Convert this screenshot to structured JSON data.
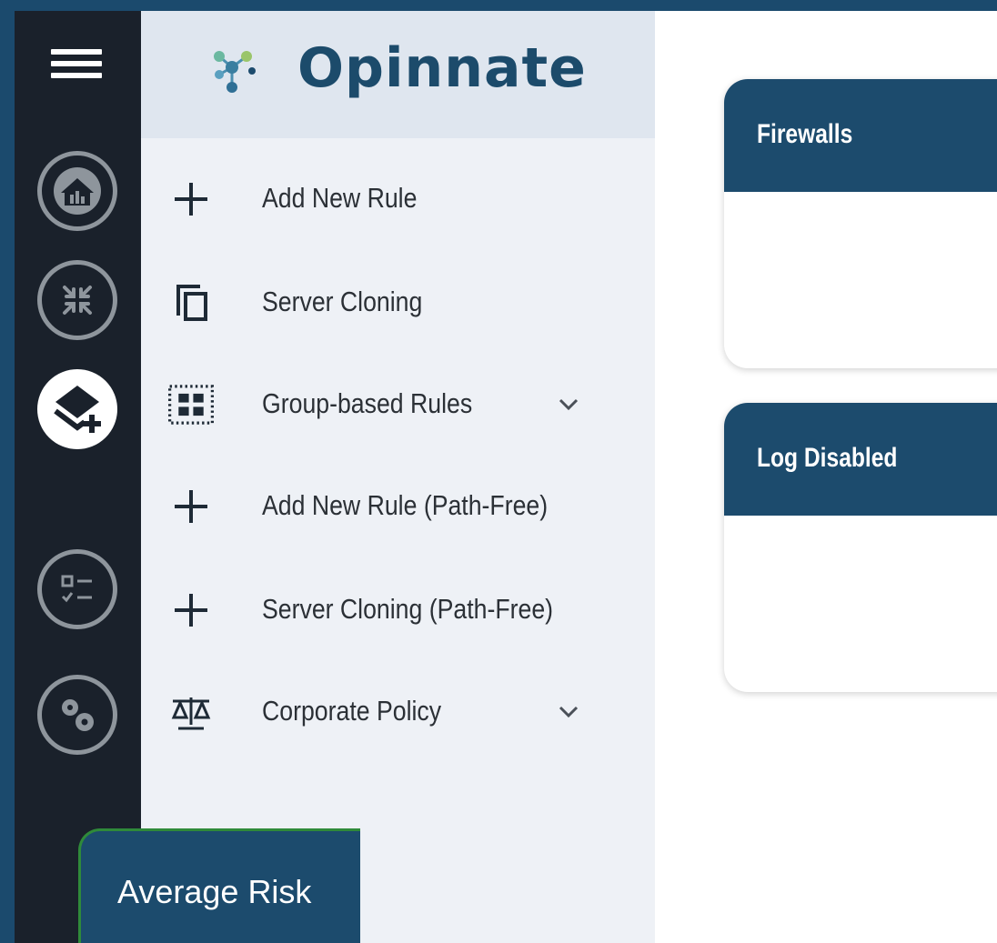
{
  "brand": {
    "name": "Opinnate"
  },
  "rail": {
    "items": [
      {
        "icon": "home-icon"
      },
      {
        "icon": "compress-icon"
      },
      {
        "icon": "add-layer-icon",
        "active": true
      },
      {
        "icon": "checklist-icon"
      },
      {
        "icon": "gears-icon"
      }
    ]
  },
  "sidebar": {
    "items": [
      {
        "label": "Add New Rule",
        "icon": "plus-icon"
      },
      {
        "label": "Server Cloning",
        "icon": "copy-icon"
      },
      {
        "label": "Group-based Rules",
        "icon": "grid-icon",
        "expandable": true
      },
      {
        "label": "Add New Rule (Path-Free)",
        "icon": "plus-icon"
      },
      {
        "label": "Server Cloning (Path-Free)",
        "icon": "plus-icon"
      },
      {
        "label": "Corporate Policy",
        "icon": "scale-icon",
        "expandable": true
      }
    ]
  },
  "cards": {
    "firewalls": {
      "title": "Firewalls"
    },
    "log_disabled": {
      "title": "Log Disabled"
    },
    "average_risk": {
      "title": "Average Risk"
    }
  },
  "colors": {
    "rail_bg": "#1a212b",
    "brand_blue": "#1c4b6d",
    "page_bg": "#1b4a6d",
    "accent_green": "#2f8a3a"
  }
}
